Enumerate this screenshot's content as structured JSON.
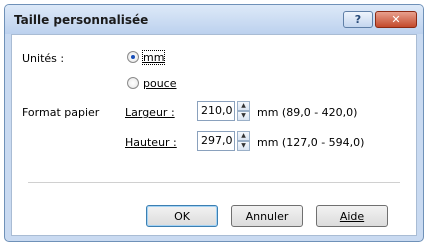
{
  "window": {
    "title": "Taille personnalisée",
    "help_label": "?",
    "close_label": "✕"
  },
  "units": {
    "label": "Unités :",
    "options": [
      {
        "label": "mm",
        "selected": true
      },
      {
        "label": "pouce",
        "selected": false
      }
    ]
  },
  "paper": {
    "label": "Format papier",
    "width": {
      "label": "Largeur :",
      "value": "210,0",
      "range": "mm (89,0 - 420,0)"
    },
    "height": {
      "label": "Hauteur :",
      "value": "297,0",
      "range": "mm (127,0 - 594,0)"
    }
  },
  "buttons": {
    "ok": "OK",
    "cancel": "Annuler",
    "help": "Aide"
  },
  "icons": {
    "spin_up": "▲",
    "spin_down": "▼"
  }
}
